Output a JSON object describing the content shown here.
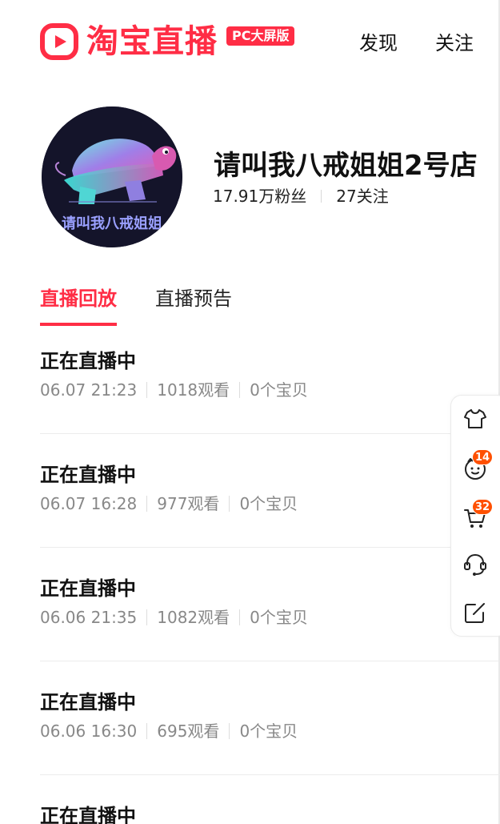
{
  "header": {
    "logo_text": "淘宝直播",
    "badge": "PC大屏版",
    "nav": [
      "发现",
      "关注"
    ]
  },
  "profile": {
    "avatar_text": "请叫我八戒姐姐",
    "name": "请叫我八戒姐姐2号店",
    "fans": "17.91万粉丝",
    "following": "27关注"
  },
  "tabs": [
    {
      "label": "直播回放",
      "active": true
    },
    {
      "label": "直播预告",
      "active": false
    }
  ],
  "lives": [
    {
      "title": "正在直播中",
      "time": "06.07 21:23",
      "views": "1018观看",
      "items": "0个宝贝"
    },
    {
      "title": "正在直播中",
      "time": "06.07 16:28",
      "views": "977观看",
      "items": "0个宝贝"
    },
    {
      "title": "正在直播中",
      "time": "06.06 21:35",
      "views": "1082观看",
      "items": "0个宝贝"
    },
    {
      "title": "正在直播中",
      "time": "06.06 16:30",
      "views": "695观看",
      "items": "0个宝贝"
    },
    {
      "title": "正在直播中"
    }
  ],
  "sidebar": {
    "items": [
      {
        "icon": "shirt-icon"
      },
      {
        "icon": "face-icon",
        "badge": "14"
      },
      {
        "icon": "cart-icon",
        "badge": "32"
      },
      {
        "icon": "headset-icon"
      },
      {
        "icon": "edit-icon"
      }
    ]
  },
  "colors": {
    "brand": "#ff2d45",
    "badge": "#ff5000",
    "meta": "#888888"
  }
}
